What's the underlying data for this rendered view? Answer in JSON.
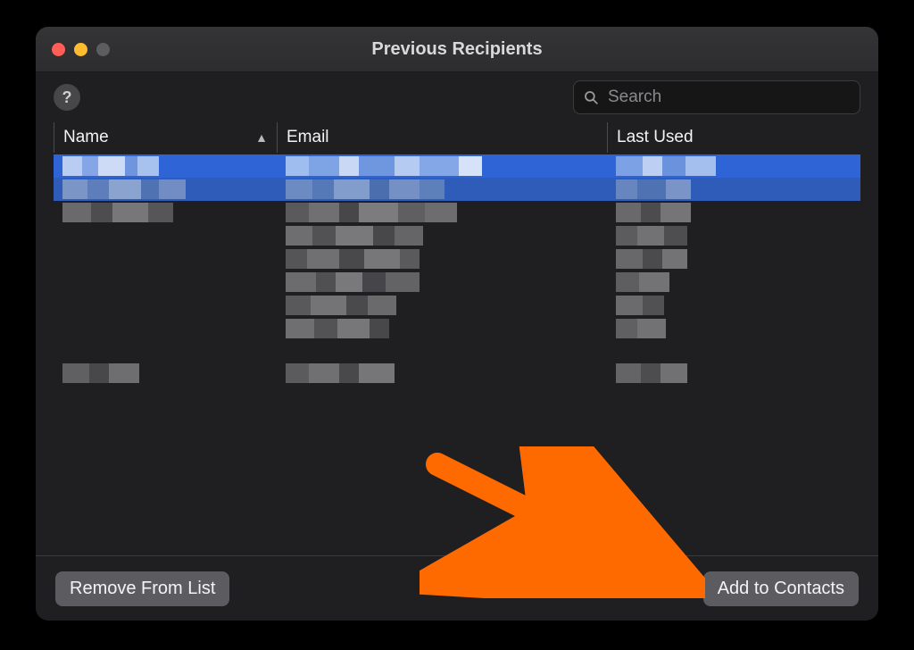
{
  "window": {
    "title": "Previous Recipients"
  },
  "traffic": {
    "close": "#ff5f57",
    "min": "#febc2e",
    "max": "#5d5d5f"
  },
  "toolbar": {
    "help_label": "?",
    "search_placeholder": "Search"
  },
  "columns": {
    "name": "Name",
    "email": "Email",
    "last_used": "Last Used",
    "sort_ascending": true
  },
  "footer": {
    "remove_label": "Remove From List",
    "add_label": "Add to Contacts"
  },
  "annotation": {
    "arrow_color": "#ff6a00"
  }
}
